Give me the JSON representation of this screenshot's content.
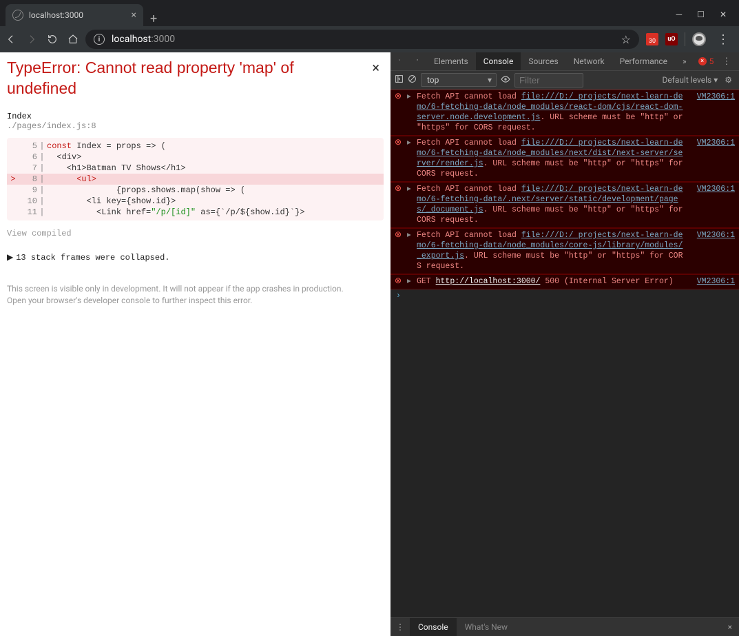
{
  "browser_tab": {
    "title": "localhost:3000"
  },
  "address": {
    "domain": "localhost",
    "path": ":3000"
  },
  "extensions": {
    "calendar_badge": "30",
    "ublock": "uO"
  },
  "error_page": {
    "title": "TypeError: Cannot read property 'map' of undefined",
    "component": "Index",
    "file": "./pages/index.js:8",
    "code": [
      {
        "n": "5",
        "ptr": "",
        "hl": false,
        "raw": "const Index = props => (",
        "kw": "const",
        "rest": " Index = props => ("
      },
      {
        "n": "6",
        "ptr": "",
        "hl": false,
        "raw": "  <div>"
      },
      {
        "n": "7",
        "ptr": "",
        "hl": false,
        "raw": "    <h1>Batman TV Shows</h1>"
      },
      {
        "n": "8",
        "ptr": ">",
        "hl": true,
        "raw": "      <ul>"
      },
      {
        "n": "9",
        "ptr": "",
        "hl": false,
        "raw": "              {props.shows.map(show => ("
      },
      {
        "n": "10",
        "ptr": "",
        "hl": false,
        "raw": "        <li key={show.id}>"
      },
      {
        "n": "11",
        "ptr": "",
        "hl": false,
        "href": "\"/p/[id]\"",
        "as": "{`/p/${show.id}`}"
      }
    ],
    "view_compiled": "View compiled",
    "collapsed": "13 stack frames were collapsed.",
    "footer1": "This screen is visible only in development. It will not appear if the app crashes in production.",
    "footer2": "Open your browser's developer console to further inspect this error."
  },
  "devtools": {
    "tabs": [
      "Elements",
      "Console",
      "Sources",
      "Network",
      "Performance"
    ],
    "active_tab": "Console",
    "more": "»",
    "error_count": "5",
    "context": "top",
    "filter_placeholder": "Filter",
    "levels": "Default levels ▾",
    "messages": [
      {
        "type": "err",
        "source": "VM2306:1",
        "pre": "Fetch API cannot load ",
        "url": "file:///D:/ projects/next-learn-demo/6-fetching-data/node_modules/react-dom/cjs/react-dom-server.node.development.js",
        "post": ". URL scheme must be \"http\" or \"https\" for CORS request."
      },
      {
        "type": "err",
        "source": "VM2306:1",
        "pre": "Fetch API cannot load ",
        "url": "file:///D:/ projects/next-learn-demo/6-fetching-data/node_modules/next/dist/next-server/server/render.js",
        "post": ". URL scheme must be \"http\" or \"https\" for CORS request."
      },
      {
        "type": "err",
        "source": "VM2306:1",
        "pre": "Fetch API cannot load ",
        "url": "file:///D:/ projects/next-learn-demo/6-fetching-data/.next/server/static/development/pages/_document.js",
        "post": ". URL scheme must be \"http\" or \"https\" for CORS request."
      },
      {
        "type": "err",
        "source": "VM2306:1",
        "pre": "Fetch API cannot load ",
        "url": "file:///D:/ projects/next-learn-demo/6-fetching-data/node_modules/core-js/library/modules/_export.js",
        "post": ". URL scheme must be \"http\" or \"https\" for CORS request."
      },
      {
        "type": "err",
        "source": "VM2306:1",
        "pre": "GET ",
        "url": "http://localhost:3000/",
        "post": " 500 (Internal Server Error)",
        "white_url": true
      }
    ],
    "drawer": {
      "active": "Console",
      "inactive": "What's New"
    }
  }
}
